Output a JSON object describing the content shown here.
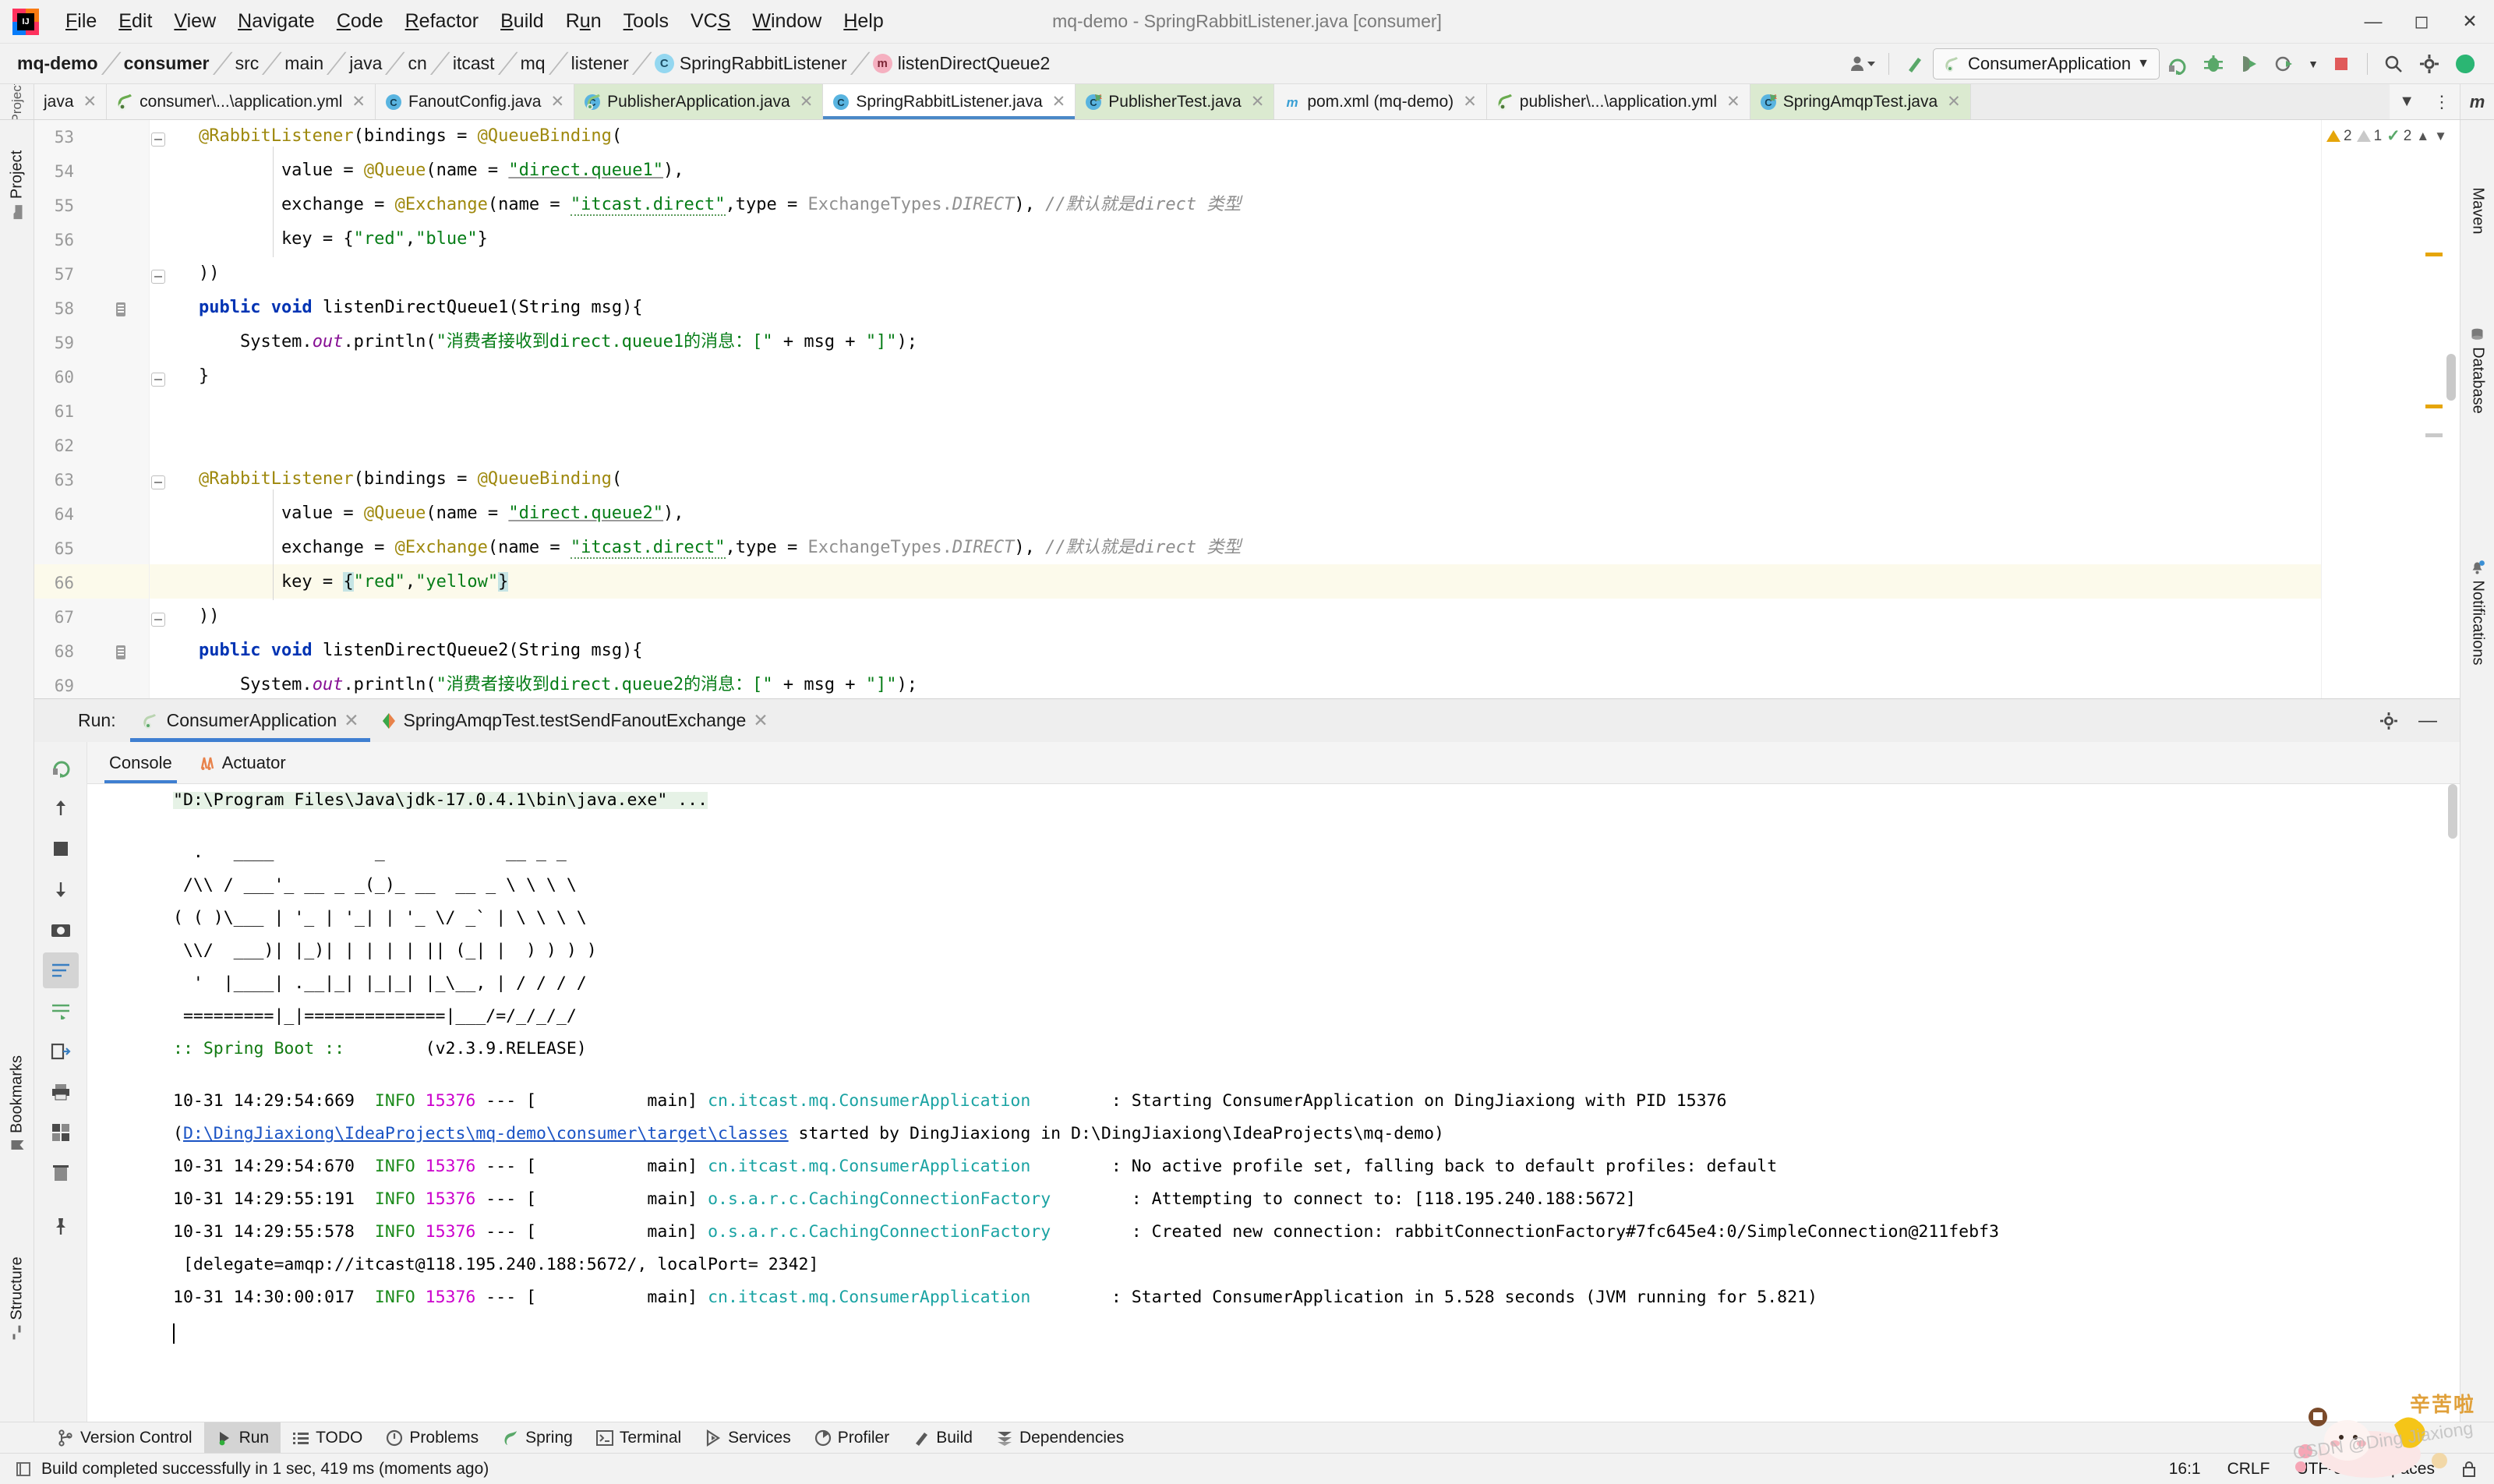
{
  "window": {
    "title": "mq-demo - SpringRabbitListener.java [consumer]",
    "minimize_icon": "minimize-icon",
    "maximize_icon": "maximize-icon",
    "close_icon": "close-icon"
  },
  "menubar": {
    "items": [
      {
        "label": "File",
        "mnemonic": "F"
      },
      {
        "label": "Edit",
        "mnemonic": "E"
      },
      {
        "label": "View",
        "mnemonic": "V"
      },
      {
        "label": "Navigate",
        "mnemonic": "N"
      },
      {
        "label": "Code",
        "mnemonic": "C"
      },
      {
        "label": "Refactor",
        "mnemonic": "R"
      },
      {
        "label": "Build",
        "mnemonic": "B"
      },
      {
        "label": "Run",
        "mnemonic": "u"
      },
      {
        "label": "Tools",
        "mnemonic": "T"
      },
      {
        "label": "VCS",
        "mnemonic": "S"
      },
      {
        "label": "Window",
        "mnemonic": "W"
      },
      {
        "label": "Help",
        "mnemonic": "H"
      }
    ]
  },
  "breadcrumb": {
    "items": [
      {
        "label": "mq-demo",
        "bold": true
      },
      {
        "label": "consumer",
        "bold": true
      },
      {
        "label": "src"
      },
      {
        "label": "main"
      },
      {
        "label": "java"
      },
      {
        "label": "cn"
      },
      {
        "label": "itcast"
      },
      {
        "label": "mq"
      },
      {
        "label": "listener"
      },
      {
        "label": "SpringRabbitListener",
        "badge": "C"
      },
      {
        "label": "listenDirectQueue2",
        "badge": "m"
      }
    ]
  },
  "toolbar": {
    "run_config": "ConsumerApplication",
    "icons": [
      "user-dropdown-icon",
      "build-hammer-icon",
      "run-icon",
      "debug-icon",
      "run-with-coverage-icon",
      "profile-icon",
      "stop-icon",
      "search-icon",
      "settings-gear-icon",
      "ide-help-icon"
    ]
  },
  "editor_tabs": [
    {
      "label": "java",
      "icon": "java-file-icon",
      "style": "plain",
      "active": false
    },
    {
      "label": "consumer\\...\\application.yml",
      "icon": "spring-yaml-icon",
      "style": "plain",
      "active": false
    },
    {
      "label": "FanoutConfig.java",
      "icon": "java-class-icon",
      "style": "plain",
      "active": false
    },
    {
      "label": "PublisherApplication.java",
      "icon": "spring-boot-class-icon",
      "style": "green",
      "active": false
    },
    {
      "label": "SpringRabbitListener.java",
      "icon": "java-class-icon",
      "style": "active",
      "active": true
    },
    {
      "label": "PublisherTest.java",
      "icon": "java-test-class-icon",
      "style": "green",
      "active": false
    },
    {
      "label": "pom.xml (mq-demo)",
      "icon": "maven-icon",
      "style": "plain",
      "active": false
    },
    {
      "label": "publisher\\...\\application.yml",
      "icon": "spring-yaml-icon",
      "style": "plain",
      "active": false
    },
    {
      "label": "SpringAmqpTest.java",
      "icon": "java-test-class-icon",
      "style": "green",
      "active": false
    }
  ],
  "editor_tab_overflow": {
    "chevron": "chevron-down-icon",
    "more": "more-vertical-icon"
  },
  "left_rail": [
    {
      "label": "Project",
      "icon": "project-folder-icon"
    },
    {
      "label": "Bookmarks",
      "icon": "bookmarks-icon"
    },
    {
      "label": "Structure",
      "icon": "structure-icon"
    }
  ],
  "right_rail": [
    {
      "label": "Maven",
      "icon": "maven-m-icon"
    },
    {
      "label": "Database",
      "icon": "database-icon"
    },
    {
      "label": "Notifications",
      "icon": "notifications-bell-icon"
    }
  ],
  "inspection": {
    "warnings": "2",
    "weak_warnings": "1",
    "checks": "2",
    "chevron_up": "chevron-up-icon",
    "chevron_down": "chevron-down-icon"
  },
  "code": {
    "first_line": 53,
    "highlighted_line": 66,
    "lines": [
      {
        "n": 53,
        "tokens": [
          {
            "t": "    ",
            "c": ""
          },
          {
            "t": "@RabbitListener",
            "c": "ann"
          },
          {
            "t": "(bindings = ",
            "c": ""
          },
          {
            "t": "@QueueBinding",
            "c": "ann"
          },
          {
            "t": "(",
            "c": ""
          }
        ]
      },
      {
        "n": 54,
        "tokens": [
          {
            "t": "            value = ",
            "c": ""
          },
          {
            "t": "@Queue",
            "c": "ann"
          },
          {
            "t": "(name = ",
            "c": ""
          },
          {
            "t": "\"direct.queue1\"",
            "c": "str ulink"
          },
          {
            "t": "),",
            "c": ""
          }
        ]
      },
      {
        "n": 55,
        "tokens": [
          {
            "t": "            exchange = ",
            "c": ""
          },
          {
            "t": "@Exchange",
            "c": "ann"
          },
          {
            "t": "(name = ",
            "c": ""
          },
          {
            "t": "\"itcast.direct\"",
            "c": "str squig"
          },
          {
            "t": ",type = ",
            "c": ""
          },
          {
            "t": "ExchangeTypes",
            "c": "grey"
          },
          {
            "t": ".",
            "c": "grey"
          },
          {
            "t": "DIRECT",
            "c": "grey fld"
          },
          {
            "t": "), ",
            "c": ""
          },
          {
            "t": "//默认就是direct 类型",
            "c": "cmt"
          }
        ]
      },
      {
        "n": 56,
        "tokens": [
          {
            "t": "            key = {",
            "c": ""
          },
          {
            "t": "\"red\"",
            "c": "str"
          },
          {
            "t": ",",
            "c": ""
          },
          {
            "t": "\"blue\"",
            "c": "str"
          },
          {
            "t": "}",
            "c": ""
          }
        ]
      },
      {
        "n": 57,
        "tokens": [
          {
            "t": "    ))",
            "c": ""
          }
        ]
      },
      {
        "n": 58,
        "tokens": [
          {
            "t": "    ",
            "c": ""
          },
          {
            "t": "public void ",
            "c": "k"
          },
          {
            "t": "listenDirectQueue1",
            "c": "typ"
          },
          {
            "t": "(",
            "c": ""
          },
          {
            "t": "String ",
            "c": "typ"
          },
          {
            "t": "msg){",
            "c": ""
          }
        ]
      },
      {
        "n": 59,
        "tokens": [
          {
            "t": "        System.",
            "c": ""
          },
          {
            "t": "out",
            "c": "fld"
          },
          {
            "t": ".println(",
            "c": ""
          },
          {
            "t": "\"消费者接收到direct.queue1的消息：[\"",
            "c": "str"
          },
          {
            "t": " + msg + ",
            "c": ""
          },
          {
            "t": "\"]\"",
            "c": "str"
          },
          {
            "t": ");",
            "c": ""
          }
        ]
      },
      {
        "n": 60,
        "tokens": [
          {
            "t": "    }",
            "c": ""
          }
        ]
      },
      {
        "n": 61,
        "tokens": []
      },
      {
        "n": 62,
        "tokens": []
      },
      {
        "n": 63,
        "tokens": [
          {
            "t": "    ",
            "c": ""
          },
          {
            "t": "@RabbitListener",
            "c": "ann"
          },
          {
            "t": "(bindings = ",
            "c": ""
          },
          {
            "t": "@QueueBinding",
            "c": "ann"
          },
          {
            "t": "(",
            "c": ""
          }
        ]
      },
      {
        "n": 64,
        "tokens": [
          {
            "t": "            value = ",
            "c": ""
          },
          {
            "t": "@Queue",
            "c": "ann"
          },
          {
            "t": "(name = ",
            "c": ""
          },
          {
            "t": "\"direct.queue2\"",
            "c": "str ulink"
          },
          {
            "t": "),",
            "c": ""
          }
        ]
      },
      {
        "n": 65,
        "tokens": [
          {
            "t": "            exchange = ",
            "c": ""
          },
          {
            "t": "@Exchange",
            "c": "ann"
          },
          {
            "t": "(name = ",
            "c": ""
          },
          {
            "t": "\"itcast.direct\"",
            "c": "str squig"
          },
          {
            "t": ",type = ",
            "c": ""
          },
          {
            "t": "ExchangeTypes",
            "c": "grey"
          },
          {
            "t": ".",
            "c": "grey"
          },
          {
            "t": "DIRECT",
            "c": "grey fld"
          },
          {
            "t": "), ",
            "c": ""
          },
          {
            "t": "//默认就是direct 类型",
            "c": "cmt"
          }
        ]
      },
      {
        "n": 66,
        "tokens": [
          {
            "t": "            key = ",
            "c": ""
          },
          {
            "t": "{",
            "c": "hl-band"
          },
          {
            "t": "\"red\"",
            "c": "str"
          },
          {
            "t": ",",
            "c": ""
          },
          {
            "t": "\"yellow\"",
            "c": "str"
          },
          {
            "t": "}",
            "c": "hl-band"
          }
        ]
      },
      {
        "n": 67,
        "tokens": [
          {
            "t": "    ))",
            "c": ""
          }
        ]
      },
      {
        "n": 68,
        "tokens": [
          {
            "t": "    ",
            "c": ""
          },
          {
            "t": "public void ",
            "c": "k"
          },
          {
            "t": "listenDirectQueue2",
            "c": "typ"
          },
          {
            "t": "(",
            "c": ""
          },
          {
            "t": "String ",
            "c": "typ"
          },
          {
            "t": "msg){",
            "c": ""
          }
        ]
      },
      {
        "n": 69,
        "tokens": [
          {
            "t": "        System.",
            "c": ""
          },
          {
            "t": "out",
            "c": "fld"
          },
          {
            "t": ".println(",
            "c": ""
          },
          {
            "t": "\"消费者接收到direct.queue2的消息：[\"",
            "c": "str"
          },
          {
            "t": " + msg + ",
            "c": ""
          },
          {
            "t": "\"]\"",
            "c": "str"
          },
          {
            "t": ");",
            "c": ""
          }
        ]
      }
    ]
  },
  "run_panel": {
    "label": "Run:",
    "tabs": [
      {
        "label": "ConsumerApplication",
        "icon": "spring-boot-icon",
        "active": true,
        "close": "×"
      },
      {
        "label": "SpringAmqpTest.testSendFanoutExchange",
        "icon": "junit-icon",
        "active": false,
        "close": "×"
      }
    ],
    "settings_icon": "gear-icon",
    "minimize_icon": "minimize-icon",
    "side_tools": [
      "rerun-icon",
      "scroll-up-icon",
      "stop-icon",
      "scroll-down-icon",
      "camera-icon",
      "wrap-text-icon",
      "soft-wrap-icon",
      "export-icon",
      "print-icon",
      "layout-icon",
      "trash-icon",
      "pin-icon"
    ],
    "console_tabs": [
      {
        "label": "Console",
        "icon": "console-icon",
        "active": true
      },
      {
        "label": "Actuator",
        "icon": "actuator-icon",
        "active": false
      }
    ]
  },
  "console": {
    "command": "\"D:\\Program Files\\Java\\jdk-17.0.4.1\\bin\\java.exe\" ...",
    "banner": [
      "  .   ____          _            __ _ _",
      " /\\\\ / ___'_ __ _ _(_)_ __  __ _ \\ \\ \\ \\",
      "( ( )\\___ | '_ | '_| | '_ \\/ _` | \\ \\ \\ \\",
      " \\\\/  ___)| |_)| | | | | || (_| |  ) ) ) )",
      "  '  |____| .__|_| |_|_| |_\\__, | / / / /",
      " =========|_|==============|___/=/_/_/_/"
    ],
    "boot_label": ":: Spring Boot ::",
    "boot_version": "(v2.3.9.RELEASE)",
    "log_lines": [
      {
        "time": "10-31 14:29:54:669",
        "level": "INFO",
        "pid": "15376",
        "sep": "--- [",
        "thread": "           main]",
        "logger": "cn.itcast.mq.ConsumerApplication",
        "pad": "        ",
        "message": ": Starting ConsumerApplication on DingJiaxiong with PID 15376"
      },
      {
        "continuation": true,
        "prefix": "(",
        "link": "D:\\DingJiaxiong\\IdeaProjects\\mq-demo\\consumer\\target\\classes",
        "suffix": " started by DingJiaxiong in D:\\DingJiaxiong\\IdeaProjects\\mq-demo)"
      },
      {
        "time": "10-31 14:29:54:670",
        "level": "INFO",
        "pid": "15376",
        "sep": "--- [",
        "thread": "           main]",
        "logger": "cn.itcast.mq.ConsumerApplication",
        "pad": "        ",
        "message": ": No active profile set, falling back to default profiles: default"
      },
      {
        "time": "10-31 14:29:55:191",
        "level": "INFO",
        "pid": "15376",
        "sep": "--- [",
        "thread": "           main]",
        "logger": "o.s.a.r.c.CachingConnectionFactory",
        "pad": "        ",
        "message": ": Attempting to connect to: [118.195.240.188:5672]"
      },
      {
        "time": "10-31 14:29:55:578",
        "level": "INFO",
        "pid": "15376",
        "sep": "--- [",
        "thread": "           main]",
        "logger": "o.s.a.r.c.CachingConnectionFactory",
        "pad": "        ",
        "message": ": Created new connection: rabbitConnectionFactory#7fc645e4:0/SimpleConnection@211febf3"
      },
      {
        "continuation": true,
        "plain": " [delegate=amqp://itcast@118.195.240.188:5672/, localPort= 2342]"
      },
      {
        "time": "10-31 14:30:00:017",
        "level": "INFO",
        "pid": "15376",
        "sep": "--- [",
        "thread": "           main]",
        "logger": "cn.itcast.mq.ConsumerApplication",
        "pad": "        ",
        "message": ": Started ConsumerApplication in 5.528 seconds (JVM running for 5.821)"
      }
    ]
  },
  "tool_window_bar": [
    {
      "label": "Version Control",
      "icon": "vcs-branch-icon",
      "selected": false
    },
    {
      "label": "Run",
      "icon": "run-play-icon",
      "selected": true
    },
    {
      "label": "TODO",
      "icon": "todo-list-icon",
      "selected": false
    },
    {
      "label": "Problems",
      "icon": "problems-icon",
      "selected": false
    },
    {
      "label": "Spring",
      "icon": "spring-leaf-icon",
      "selected": false
    },
    {
      "label": "Terminal",
      "icon": "terminal-icon",
      "selected": false
    },
    {
      "label": "Services",
      "icon": "services-icon",
      "selected": false
    },
    {
      "label": "Profiler",
      "icon": "profiler-icon",
      "selected": false
    },
    {
      "label": "Build",
      "icon": "build-hammer-icon",
      "selected": false
    },
    {
      "label": "Dependencies",
      "icon": "dependencies-icon",
      "selected": false
    }
  ],
  "statusbar": {
    "message": "Build completed successfully in 1 sec, 419 ms (moments ago)",
    "message_icon": "build-status-icon",
    "caret_position": "16:1",
    "line_separator": "CRLF",
    "encoding": "UTF-8",
    "indent": "4 spaces",
    "lock_icon": "read-only-lock-icon"
  },
  "watermark": {
    "sticker_text": "辛苦啦",
    "credit": "CSDN @Ding Jiaxiong"
  },
  "colors": {
    "accent_blue": "#3f7fd1",
    "tab_green": "#dbead0",
    "highlight_row": "#fcfaeb",
    "selection": "#c5e4e4",
    "string_green": "#067d17",
    "annotation_gold": "#9e880d",
    "keyword_blue": "#0033b3",
    "log_info_green": "#1a8a1a",
    "log_pid_magenta": "#cc00cc",
    "log_class_cyan": "#1aa3a3"
  }
}
